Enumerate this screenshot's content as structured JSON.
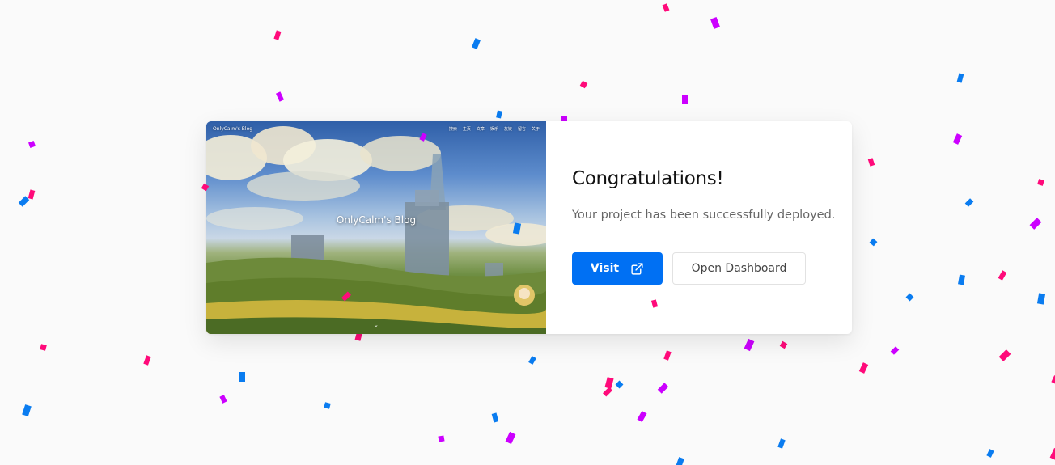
{
  "preview": {
    "brand": "OnlyCalm's Blog",
    "title": "OnlyCalm's Blog",
    "menu": [
      "搜索",
      "主页",
      "文章",
      "娱乐",
      "友链",
      "留言",
      "关于"
    ],
    "scroll_arrow": "⌄"
  },
  "main": {
    "title": "Congratulations!",
    "subtitle": "Your project has been successfully deployed.",
    "visit_label": "Visit",
    "dashboard_label": "Open Dashboard"
  },
  "colors": {
    "accent": "#0070f3",
    "confetti": [
      "#ff0a7a",
      "#cc00ff",
      "#0a7cf0"
    ]
  },
  "icons": {
    "visit_icon": "external-link-icon"
  }
}
